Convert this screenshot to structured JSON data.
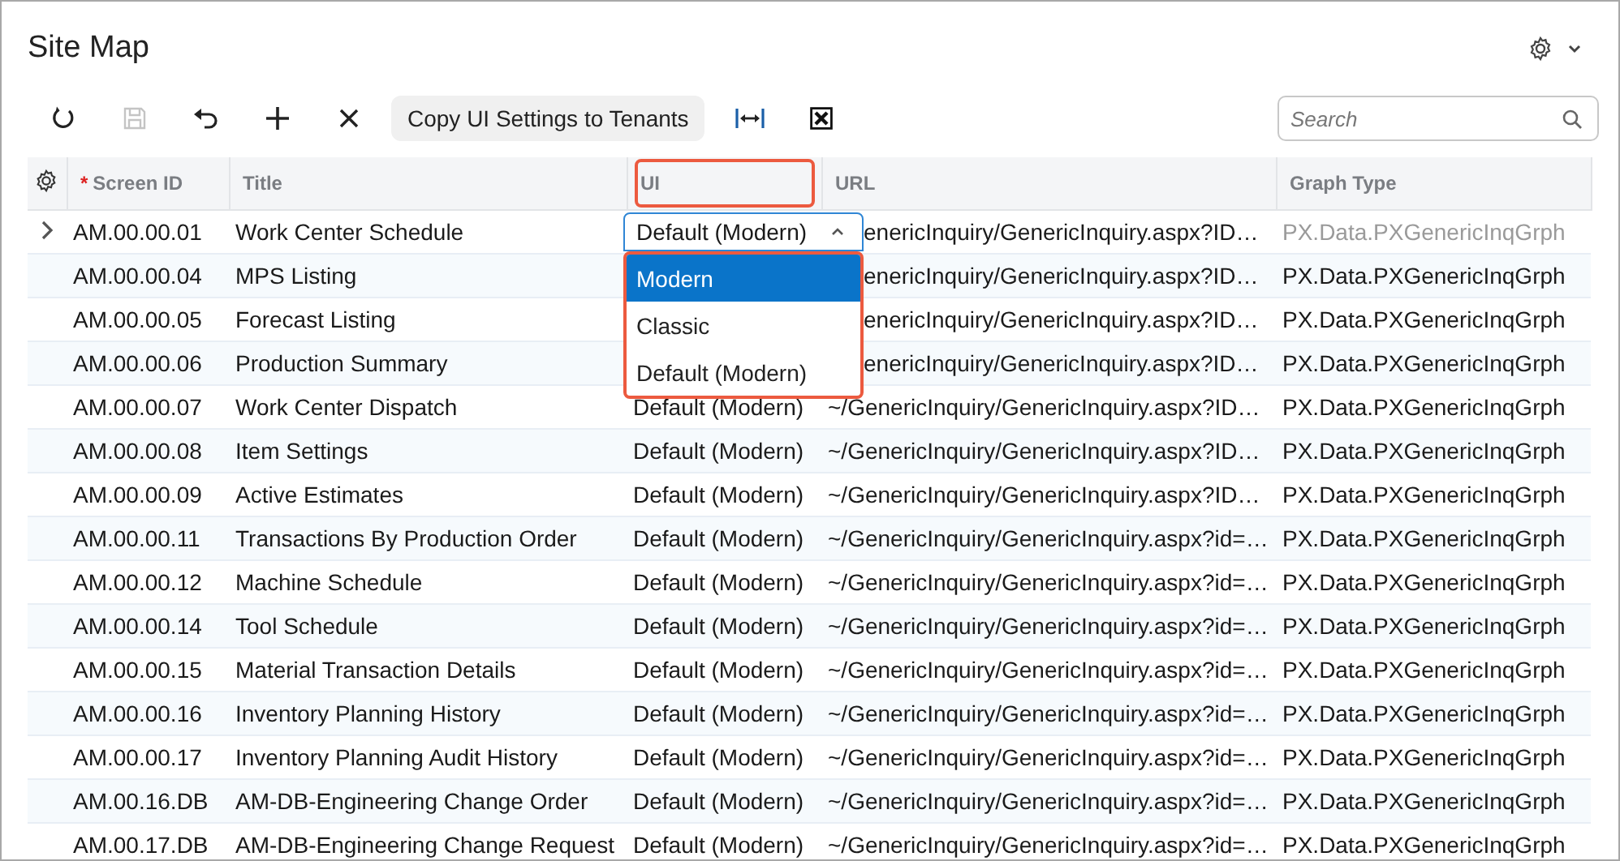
{
  "window": {
    "title": "Site Map"
  },
  "toolbar": {
    "copy_button": "Copy UI Settings to Tenants",
    "save_disabled": true,
    "search": {
      "placeholder": "Search"
    }
  },
  "table": {
    "columns": [
      {
        "label": "Screen ID",
        "required_mark": "*",
        "highlighted": false
      },
      {
        "label": "Title",
        "highlighted": false
      },
      {
        "label": "UI",
        "highlighted": true
      },
      {
        "label": "URL",
        "highlighted": false
      },
      {
        "label": "Graph Type",
        "highlighted": false
      }
    ],
    "rows": [
      {
        "screen_id": "AM.00.00.01",
        "title": "Work Center Schedule",
        "ui": "Default (Modern)",
        "url": "enericInquiry/GenericInquiry.aspx?ID…",
        "graph_type": "PX.Data.PXGenericInqGrph",
        "selected": true,
        "covered": true
      },
      {
        "screen_id": "AM.00.00.04",
        "title": "MPS Listing",
        "url": "enericInquiry/GenericInquiry.aspx?ID…",
        "graph_type": "PX.Data.PXGenericInqGrph",
        "selected": false,
        "covered": true
      },
      {
        "screen_id": "AM.00.00.05",
        "title": "Forecast Listing",
        "url": "enericInquiry/GenericInquiry.aspx?ID…",
        "graph_type": "PX.Data.PXGenericInqGrph",
        "selected": false,
        "covered": true
      },
      {
        "screen_id": "AM.00.00.06",
        "title": "Production Summary",
        "url": "enericInquiry/GenericInquiry.aspx?ID…",
        "graph_type": "PX.Data.PXGenericInqGrph",
        "selected": false,
        "covered": true
      },
      {
        "screen_id": "AM.00.00.07",
        "title": "Work Center Dispatch",
        "ui": "Default (Modern)",
        "url": "~/GenericInquiry/GenericInquiry.aspx?ID…",
        "graph_type": "PX.Data.PXGenericInqGrph",
        "selected": false,
        "covered": false
      },
      {
        "screen_id": "AM.00.00.08",
        "title": "Item Settings",
        "ui": "Default (Modern)",
        "url": "~/GenericInquiry/GenericInquiry.aspx?ID…",
        "graph_type": "PX.Data.PXGenericInqGrph",
        "selected": false,
        "covered": false
      },
      {
        "screen_id": "AM.00.00.09",
        "title": "Active Estimates",
        "ui": "Default (Modern)",
        "url": "~/GenericInquiry/GenericInquiry.aspx?ID…",
        "graph_type": "PX.Data.PXGenericInqGrph",
        "selected": false,
        "covered": false
      },
      {
        "screen_id": "AM.00.00.11",
        "title": "Transactions By Production Order",
        "ui": "Default (Modern)",
        "url": "~/GenericInquiry/GenericInquiry.aspx?id=…",
        "graph_type": "PX.Data.PXGenericInqGrph",
        "selected": false,
        "covered": false
      },
      {
        "screen_id": "AM.00.00.12",
        "title": "Machine Schedule",
        "ui": "Default (Modern)",
        "url": "~/GenericInquiry/GenericInquiry.aspx?id=…",
        "graph_type": "PX.Data.PXGenericInqGrph",
        "selected": false,
        "covered": false
      },
      {
        "screen_id": "AM.00.00.14",
        "title": "Tool Schedule",
        "ui": "Default (Modern)",
        "url": "~/GenericInquiry/GenericInquiry.aspx?id=…",
        "graph_type": "PX.Data.PXGenericInqGrph",
        "selected": false,
        "covered": false
      },
      {
        "screen_id": "AM.00.00.15",
        "title": "Material Transaction Details",
        "ui": "Default (Modern)",
        "url": "~/GenericInquiry/GenericInquiry.aspx?id=…",
        "graph_type": "PX.Data.PXGenericInqGrph",
        "selected": false,
        "covered": false
      },
      {
        "screen_id": "AM.00.00.16",
        "title": "Inventory Planning History",
        "ui": "Default (Modern)",
        "url": "~/GenericInquiry/GenericInquiry.aspx?id=…",
        "graph_type": "PX.Data.PXGenericInqGrph",
        "selected": false,
        "covered": false
      },
      {
        "screen_id": "AM.00.00.17",
        "title": "Inventory Planning Audit History",
        "ui": "Default (Modern)",
        "url": "~/GenericInquiry/GenericInquiry.aspx?id=…",
        "graph_type": "PX.Data.PXGenericInqGrph",
        "selected": false,
        "covered": false
      },
      {
        "screen_id": "AM.00.16.DB",
        "title": "AM-DB-Engineering Change Order",
        "ui": "Default (Modern)",
        "url": "~/GenericInquiry/GenericInquiry.aspx?id=…",
        "graph_type": "PX.Data.PXGenericInqGrph",
        "selected": false,
        "covered": false
      },
      {
        "screen_id": "AM.00.17.DB",
        "title": "AM-DB-Engineering Change Request",
        "ui": "Default (Modern)",
        "url": "~/GenericInquiry/GenericInquiry.aspx?id=…",
        "graph_type": "PX.Data.PXGenericInqGrph",
        "selected": false,
        "covered": false
      }
    ]
  },
  "ui_dropdown": {
    "options": [
      {
        "label": "Modern",
        "selected": true
      },
      {
        "label": "Classic",
        "selected": false
      },
      {
        "label": "Default (Modern)",
        "selected": false
      }
    ]
  }
}
